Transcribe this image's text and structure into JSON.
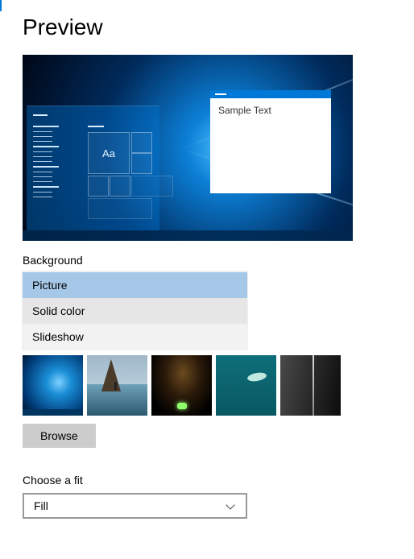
{
  "title": "Preview",
  "preview": {
    "tile_text": "Aa",
    "window_text": "Sample Text"
  },
  "background": {
    "label": "Background",
    "options": [
      "Picture",
      "Solid color",
      "Slideshow"
    ],
    "selected_index": 0
  },
  "browse_label": "Browse",
  "fit": {
    "label": "Choose a fit",
    "value": "Fill"
  },
  "thumbnails": [
    "windows-hero",
    "beach-rock",
    "night-tent",
    "underwater-diver",
    "rock-face"
  ]
}
